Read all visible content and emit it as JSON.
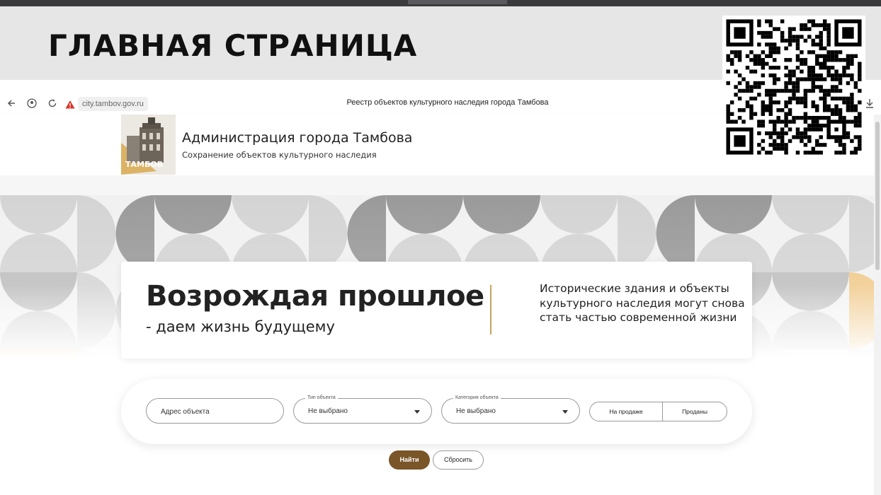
{
  "slide": {
    "title": "ГЛАВНАЯ СТРАНИЦА"
  },
  "browser": {
    "url": "city.tambov.gov.ru",
    "page_title": "Реестр объектов культурного наследия города Тамбова",
    "icons": [
      "back-arrow-icon",
      "account-icon",
      "reload-icon",
      "warning-icon",
      "download-icon"
    ]
  },
  "header": {
    "org_name": "Администрация города Тамбова",
    "org_subtitle": "Сохранение объектов культурного наследия",
    "logo_text": "ТАМБОВ"
  },
  "hero": {
    "headline": "Возрождая прошлое",
    "subheadline": "- даем жизнь будущему",
    "description": "Исторические здания и объекты культурного наследия могут снова стать частью современной жизни"
  },
  "search": {
    "address_placeholder": "Адрес объекта",
    "type_label": "Тип объекта",
    "type_value": "Не выбрано",
    "category_label": "Категория объекта",
    "category_value": "Не выбрано",
    "toggle_on_sale": "На продаже",
    "toggle_sold": "Проданы",
    "find_button": "Найти",
    "reset_button": "Сбросить"
  },
  "colors": {
    "accent_brown": "#7a5528",
    "accent_gold": "#c8a45e",
    "pattern_orange": "#f0c98a",
    "pattern_gray_dark": "#9a9a9a",
    "pattern_gray_light": "#d4d4d4"
  }
}
